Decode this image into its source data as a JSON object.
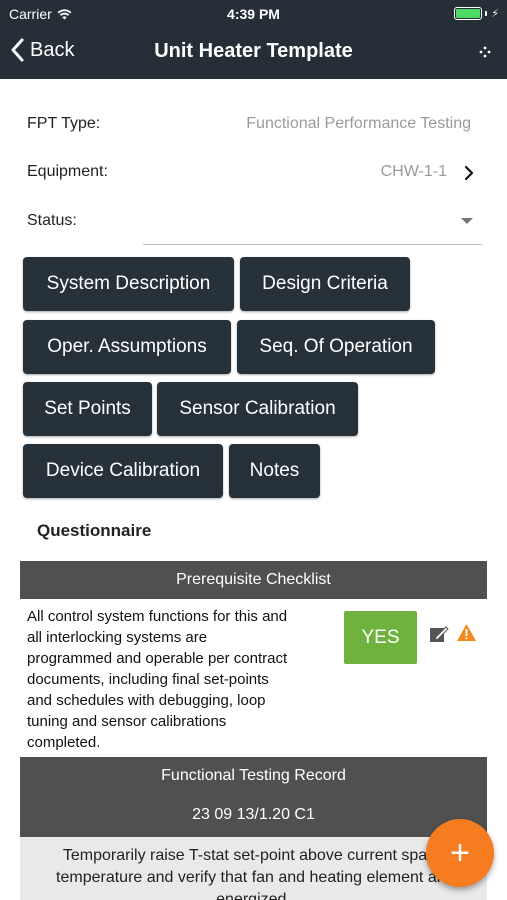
{
  "status_bar": {
    "carrier": "Carrier",
    "time": "4:39 PM",
    "battery_level": 1.0,
    "icons": [
      "wifi-icon",
      "battery-icon",
      "charging-bolt-icon"
    ]
  },
  "nav": {
    "back_label": "Back",
    "title": "Unit Heater Template",
    "back_icon": "chevron-left-icon",
    "more_icon": "dots-icon"
  },
  "form": {
    "fpt_type_label": "FPT Type:",
    "fpt_type_value": "Functional Performance Testing",
    "equipment_label": "Equipment:",
    "equipment_value": "CHW-1-1",
    "status_label": "Status:",
    "status_value": ""
  },
  "sections": [
    {
      "label": "System Description"
    },
    {
      "label": "Design Criteria"
    },
    {
      "label": "Oper. Assumptions"
    },
    {
      "label": "Seq. Of Operation"
    },
    {
      "label": "Set Points"
    },
    {
      "label": "Sensor Calibration"
    },
    {
      "label": "Device Calibration"
    },
    {
      "label": "Notes"
    }
  ],
  "questionnaire": {
    "heading": "Questionnaire",
    "prerequisite_title": "Prerequisite Checklist",
    "question_text": "All control system functions for this and all interlocking systems are programmed and operable per contract documents, including final set-points and schedules with debugging, loop tuning and sensor calibrations completed.",
    "answer_label": "YES",
    "functional_title": "Functional Testing Record",
    "functional_code": "23 09 13/1.20 C1",
    "step_text": "Temporarily raise T-stat set-point above current space temperature and verify that fan and heating element are energized."
  },
  "colors": {
    "header_bg": "#262f38",
    "button_bg": "#27313a",
    "section_bar_bg": "#505050",
    "yes_green": "#70b23e",
    "warning_orange": "#f28a1c",
    "fab_orange": "#f57c1f"
  },
  "fab_label": "+"
}
